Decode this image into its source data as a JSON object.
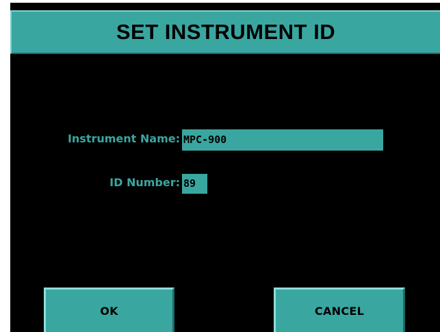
{
  "dialog": {
    "title": "SET INSTRUMENT ID"
  },
  "fields": {
    "instrument_name": {
      "label": "Instrument Name:",
      "value": "MPC-900"
    },
    "id_number": {
      "label": "ID Number:",
      "value": "89"
    }
  },
  "buttons": {
    "ok_label": "OK",
    "cancel_label": "CANCEL"
  },
  "colors": {
    "accent": "#3aa6a0",
    "background": "#000000",
    "frame": "#ffffff"
  }
}
